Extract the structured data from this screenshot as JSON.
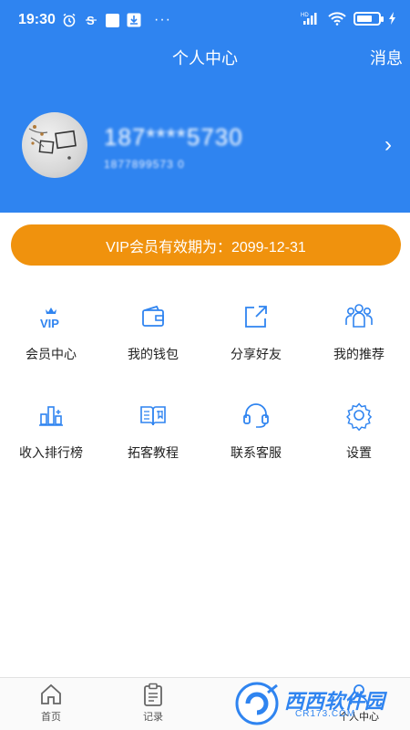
{
  "status_bar": {
    "time": "19:30",
    "dots": "···",
    "network": "HD"
  },
  "header": {
    "title": "个人中心",
    "message_link": "消息"
  },
  "profile": {
    "phone": "187****5730",
    "sub_id": "1877899573 0",
    "chevron": "›"
  },
  "vip": {
    "label": "VIP会员有效期为：2099-12-31"
  },
  "grid": {
    "vip_icon_text": "VIP",
    "items": [
      {
        "label": "会员中心",
        "icon": "vip-crown-icon"
      },
      {
        "label": "我的钱包",
        "icon": "wallet-icon"
      },
      {
        "label": "分享好友",
        "icon": "share-icon"
      },
      {
        "label": "我的推荐",
        "icon": "referral-people-icon"
      },
      {
        "label": "收入排行榜",
        "icon": "ranking-icon"
      },
      {
        "label": "拓客教程",
        "icon": "tutorial-book-icon"
      },
      {
        "label": "联系客服",
        "icon": "headset-icon"
      },
      {
        "label": "设置",
        "icon": "settings-gear-icon"
      }
    ]
  },
  "bottom_nav": {
    "items": [
      {
        "label": "首页",
        "icon": "home-icon"
      },
      {
        "label": "记录",
        "icon": "clipboard-icon"
      },
      {
        "label": "",
        "icon": "partially-hidden-icon"
      },
      {
        "label": "个人中心",
        "icon": "profile-icon"
      }
    ]
  },
  "watermark": {
    "text": "西西软件园",
    "sub": "CR173.COM"
  },
  "colors": {
    "primary_blue": "#2f84f0",
    "vip_orange": "#f0920d",
    "icon_blue": "#2f84f0"
  }
}
